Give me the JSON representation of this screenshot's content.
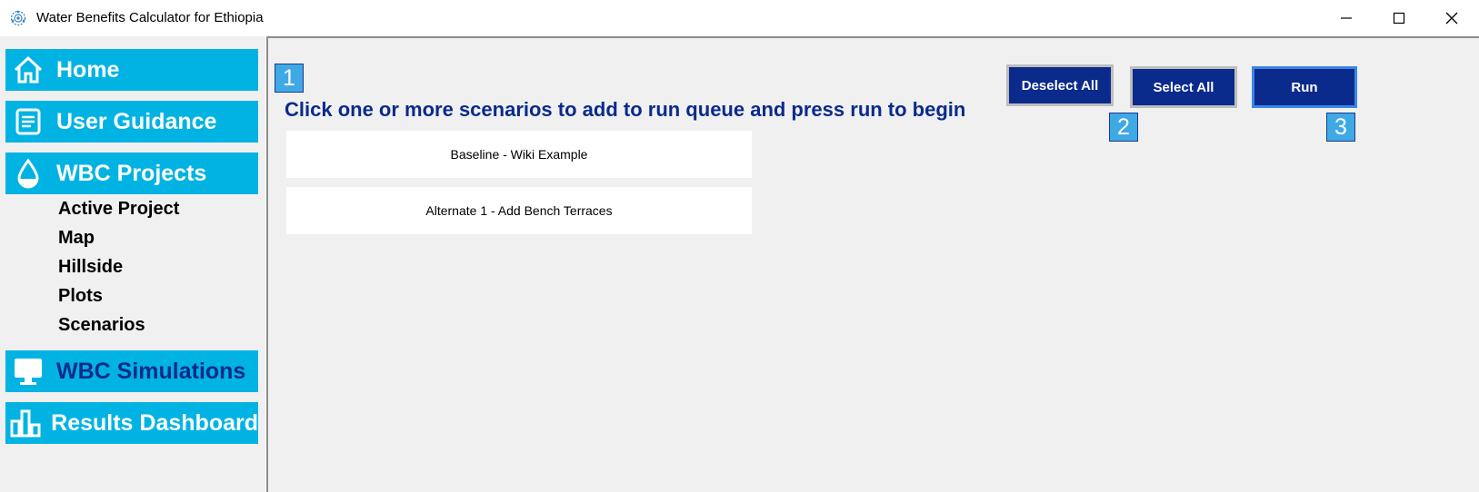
{
  "window": {
    "title": "Water Benefits Calculator for Ethiopia",
    "icon": "network-globe-icon",
    "controls": [
      "minimize-icon",
      "maximize-icon",
      "close-icon"
    ]
  },
  "sidebar": {
    "items": [
      {
        "label": "Home",
        "icon": "home-icon"
      },
      {
        "label": "User Guidance",
        "icon": "document-icon"
      },
      {
        "label": "WBC Projects",
        "icon": "water-drop-icon"
      },
      {
        "label": "WBC Simulations",
        "icon": "monitor-icon"
      },
      {
        "label": "Results Dashboard",
        "icon": "bar-chart-icon"
      }
    ],
    "project_subitems": [
      "Active Project",
      "Map",
      "Hillside",
      "Plots",
      "Scenarios"
    ],
    "active_item": "WBC Simulations"
  },
  "main": {
    "instruction": "Click one or more scenarios to add to run queue and press run to begin",
    "scenarios": [
      "Baseline - Wiki Example",
      "Alternate 1 - Add Bench Terraces"
    ],
    "buttons": {
      "deselect_all": "Deselect All",
      "select_all": "Select All",
      "run": "Run"
    },
    "callouts": [
      "1",
      "2",
      "3"
    ]
  },
  "colors": {
    "nav_bg": "#00b3e3",
    "nav_active_text": "#0a2a8c",
    "button_bg": "#0a2a8c",
    "callout_bg": "#3fa9e6",
    "panel_bg": "#f0f0f0"
  }
}
